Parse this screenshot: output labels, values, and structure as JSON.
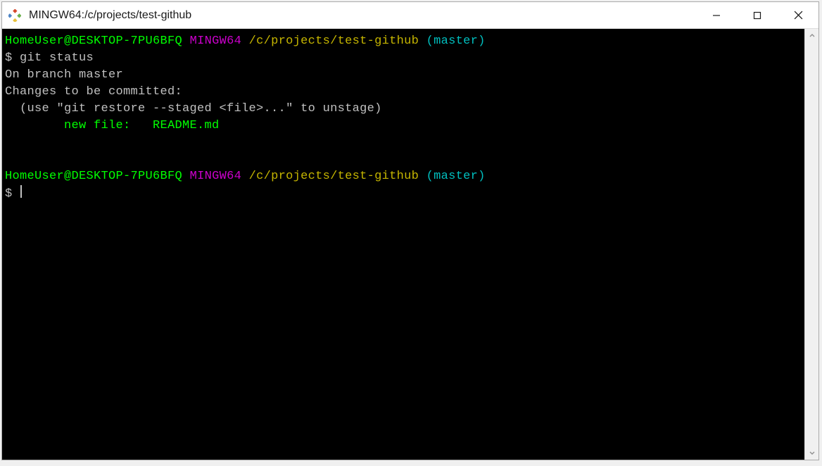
{
  "window": {
    "title": "MINGW64:/c/projects/test-github"
  },
  "prompt": {
    "user_host": "HomeUser@DESKTOP-7PU6BFQ",
    "shell": "MINGW64",
    "cwd": "/c/projects/test-github",
    "branch": "(master)",
    "symbol": "$"
  },
  "terminal": {
    "command1": "git status",
    "out_line1": "On branch master",
    "out_line2": "Changes to be committed:",
    "out_line3": "  (use \"git restore --staged <file>...\" to unstage)",
    "out_line4_prefix": "        new file:   ",
    "out_line4_file": "README.md"
  }
}
